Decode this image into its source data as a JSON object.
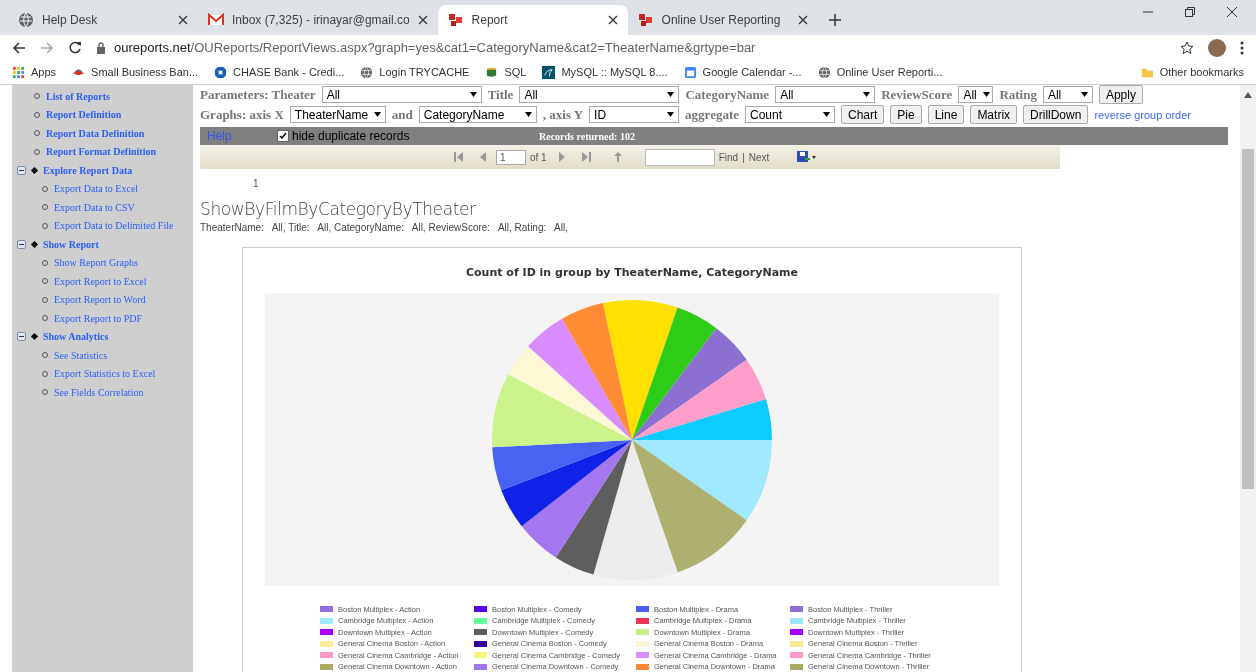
{
  "browser": {
    "tabs": [
      {
        "title": "Help Desk",
        "kind": "globe",
        "selected": false
      },
      {
        "title": "Inbox (7,325) - irinayar@gmail.co",
        "kind": "mail",
        "selected": false
      },
      {
        "title": "Report",
        "kind": "report",
        "selected": true
      },
      {
        "title": "Online User Reporting",
        "kind": "report",
        "selected": false
      }
    ],
    "address": {
      "domain": "oureports.net",
      "path": "/OUReports/ReportViews.aspx?graph=yes&cat1=CategoryName&cat2=TheaterName&grtype=bar"
    },
    "bookmarks": [
      {
        "label": "Apps",
        "kind": "apps"
      },
      {
        "label": "Small Business Ban...",
        "kind": "bank"
      },
      {
        "label": "CHASE Bank - Credi...",
        "kind": "chase"
      },
      {
        "label": "Login TRYCACHE",
        "kind": "globe"
      },
      {
        "label": "SQL",
        "kind": "sql"
      },
      {
        "label": "MySQL :: MySQL 8....",
        "kind": "mysql"
      },
      {
        "label": "Google Calendar -...",
        "kind": "calendar"
      },
      {
        "label": "Online User Reporti...",
        "kind": "globe"
      }
    ],
    "other_bookmarks": "Other bookmarks"
  },
  "sidebar": {
    "items": [
      {
        "label": "List of Reports",
        "kind": "link"
      },
      {
        "label": "Report Definition",
        "kind": "link"
      },
      {
        "label": "Report Data Definition",
        "kind": "link"
      },
      {
        "label": "Report Format Definition",
        "kind": "link"
      },
      {
        "label": "Explore Report Data",
        "kind": "section",
        "expanded": true,
        "children": [
          {
            "label": "Export Data to Excel"
          },
          {
            "label": "Export Data to CSV"
          },
          {
            "label": "Export Data to Delimited File"
          }
        ]
      },
      {
        "label": "Show Report",
        "kind": "section",
        "expanded": true,
        "children": [
          {
            "label": "Show Report Graphs"
          },
          {
            "label": "Export Report to Excel"
          },
          {
            "label": "Export Report to Word"
          },
          {
            "label": "Export Report to PDF"
          }
        ]
      },
      {
        "label": "Show Analytics",
        "kind": "section",
        "expanded": true,
        "children": [
          {
            "label": "See Statistics"
          },
          {
            "label": "Export Statistics to Excel"
          },
          {
            "label": "See Fields Correlation"
          }
        ]
      }
    ]
  },
  "parameters": {
    "fields": [
      {
        "label": "Parameters: Theater",
        "value": "All"
      },
      {
        "label": "Title",
        "value": "All"
      },
      {
        "label": "CategoryName",
        "value": "All"
      },
      {
        "label": "ReviewScore",
        "value": "All"
      },
      {
        "label": "Rating",
        "value": "All"
      }
    ],
    "apply": "Apply"
  },
  "graphs": {
    "label_x": "Graphs: axis X",
    "axis_x": "TheaterName",
    "and": "and",
    "category_2": "CategoryName",
    "label_y": ", axis Y",
    "axis_y": "ID",
    "label_aggregate": "aggregate",
    "aggregate": "Count",
    "buttons": [
      "Chart",
      "Pie",
      "Line",
      "Matrix",
      "DrillDown"
    ],
    "reverse_link": "reverse group order"
  },
  "status_bar": {
    "help": "Help",
    "hide_duplicates": {
      "label": "hide duplicate records",
      "checked": true
    },
    "records": "Records returned: 102"
  },
  "pager": {
    "page": "1",
    "of": "of 1",
    "find": "Find",
    "separator": "|",
    "next": "Next"
  },
  "page_number": "1",
  "report": {
    "title": "ShowByFilmByCategoryByTheater",
    "filters": "TheaterName:   All, Title:   All, CategoryName:   All, ReviewScore:   All, Rating:   All,"
  },
  "chart": {
    "title": "Count of ID in group by TheaterName, CategoryName",
    "kind": "picture",
    "legend": [
      {
        "label": "Boston Multiplex - Action",
        "color": "#9370db"
      },
      {
        "label": "Boston Multiplex - Comedy",
        "color": "#5500ee"
      },
      {
        "label": "Boston Multiplex - Drama",
        "color": "#4a5ef5"
      },
      {
        "label": "Boston Multiplex - Thriller",
        "color": "#8f6fd0"
      },
      {
        "label": "Cambridge Multiplex - Action",
        "color": "#a0e8ff"
      },
      {
        "label": "Cambridge Multiplex - Comedy",
        "color": "#66ff99"
      },
      {
        "label": "Cambridge Multiplex - Drama",
        "color": "#ee3355"
      },
      {
        "label": "Cambridge Multiplex - Thriller",
        "color": "#9fe6fd"
      },
      {
        "label": "Downtown Multiplex - Action",
        "color": "#aa00ff"
      },
      {
        "label": "Downtown Multiplex - Comedy",
        "color": "#5e5e5e"
      },
      {
        "label": "Downtown Multiplex - Drama",
        "color": "#c8f08a"
      },
      {
        "label": "Downtown Multiplex - Thriller",
        "color": "#a900fe"
      },
      {
        "label": "General Cinema Boston - Action",
        "color": "#ffe99a"
      },
      {
        "label": "General Cinema Boston - Comedy",
        "color": "#330099"
      },
      {
        "label": "General Cinema Boston - Drama",
        "color": "#fff6d5"
      },
      {
        "label": "General Cinema Boston - Thriller",
        "color": "#fee899"
      },
      {
        "label": "General Cinema Cambridge - Action",
        "color": "#ff99cc"
      },
      {
        "label": "General Cinema Cambridge - Comedy",
        "color": "#f5f57a"
      },
      {
        "label": "General Cinema Cambridge - Drama",
        "color": "#d890ff"
      },
      {
        "label": "General Cinema Cambridge - Thriller",
        "color": "#fe98cb"
      },
      {
        "label": "General Cinema Downtown - Action",
        "color": "#aaaa66"
      },
      {
        "label": "General Cinema Downtown - Comedy",
        "color": "#a077ee"
      },
      {
        "label": "General Cinema Downtown - Drama",
        "color": "#ff8833"
      },
      {
        "label": "General Cinema Downtown - Thriller",
        "color": "#a9a965"
      }
    ]
  }
}
